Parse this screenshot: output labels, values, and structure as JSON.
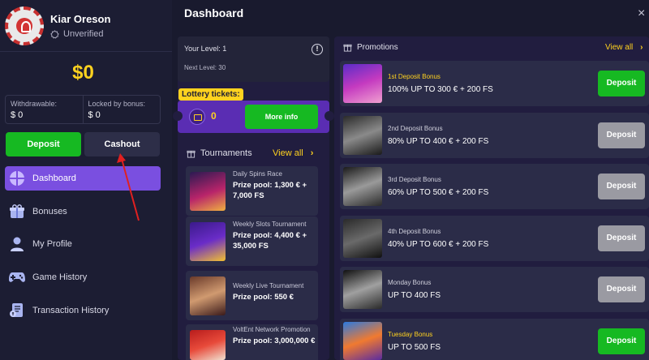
{
  "profile": {
    "name": "Kiar Oreson",
    "status": "Unverified"
  },
  "balance": {
    "amount": "$0",
    "withdrawable_label": "Withdrawable:",
    "withdrawable_value": "$ 0",
    "locked_label": "Locked by bonus:",
    "locked_value": "$ 0"
  },
  "actions": {
    "deposit_label": "Deposit",
    "cashout_label": "Cashout"
  },
  "nav": [
    {
      "label": "Dashboard",
      "icon": "dashboard-icon"
    },
    {
      "label": "Bonuses",
      "icon": "gift-icon"
    },
    {
      "label": "My Profile",
      "icon": "user-icon"
    },
    {
      "label": "Game History",
      "icon": "gamepad-icon"
    },
    {
      "label": "Transaction History",
      "icon": "transactions-icon"
    }
  ],
  "header": {
    "title": "Dashboard",
    "close": "×"
  },
  "level": {
    "current": "Your Level: 1",
    "next": "Next Level: 30",
    "info": "!"
  },
  "lottery": {
    "label": "Lottery tickets:",
    "count": "0",
    "button": "More info"
  },
  "tournaments": {
    "title": "Tournaments",
    "view_all": "View all",
    "chevron": "›",
    "items": [
      {
        "name": "Daily Spins Race",
        "prize": "Prize pool: 1,300 € + 7,000 FS"
      },
      {
        "name": "Weekly Slots Tournament",
        "prize": "Prize pool: 4,400 € + 35,000 FS"
      },
      {
        "name": "Weekly Live Tournament",
        "prize": "Prize pool: 550 €"
      },
      {
        "name": "VoltEnt Network Promotion",
        "prize": "Prize pool: 3,000,000 €"
      }
    ]
  },
  "promotions": {
    "title": "Promotions",
    "view_all": "View all",
    "chevron": "›",
    "items": [
      {
        "title": "1st Deposit Bonus",
        "desc": "100% UP TO 300 € + 200 FS",
        "button": "Deposit",
        "active": true
      },
      {
        "title": "2nd Deposit Bonus",
        "desc": "80% UP TO 400 € + 200 FS",
        "button": "Deposit",
        "active": false
      },
      {
        "title": "3rd Deposit Bonus",
        "desc": "60% UP TO 500 € + 200 FS",
        "button": "Deposit",
        "active": false
      },
      {
        "title": "4th Deposit Bonus",
        "desc": "40% UP TO 600 € + 200 FS",
        "button": "Deposit",
        "active": false
      },
      {
        "title": "Monday Bonus",
        "desc": "UP TO 400 FS",
        "button": "Deposit",
        "active": false
      },
      {
        "title": "Tuesday Bonus",
        "desc": "UP TO 500 FS",
        "button": "Deposit",
        "active": true
      }
    ]
  },
  "colors": {
    "accent_purple": "#7a4fe0",
    "green": "#16b922",
    "yellow": "#ffd21f",
    "annotation_red": "#e02020"
  }
}
